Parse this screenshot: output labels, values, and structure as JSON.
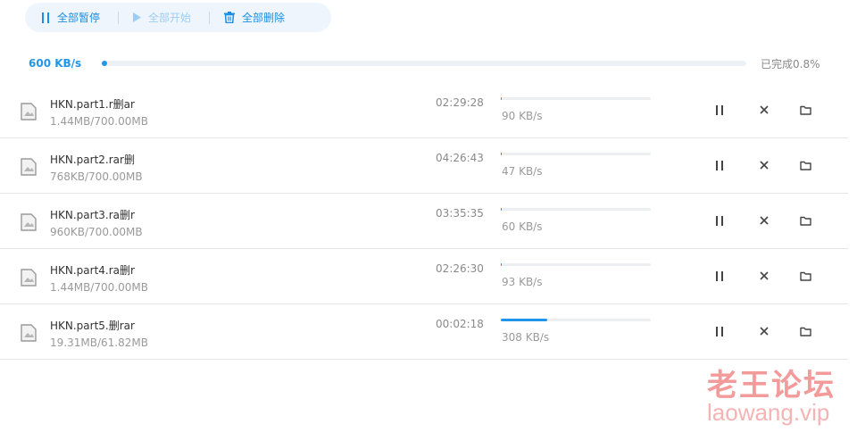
{
  "toolbar": {
    "pause_all_label": "全部暂停",
    "start_all_label": "全部开始",
    "delete_all_label": "全部删除"
  },
  "overall": {
    "speed": "600 KB/s",
    "status": "已完成0.8%",
    "progress_percent": 0.8
  },
  "downloads": [
    {
      "name": "HKN.part1.r删ar",
      "size": "1.44MB/700.00MB",
      "time_left": "02:29:28",
      "speed": "90 KB/s",
      "progress": 0.002
    },
    {
      "name": "HKN.part2.rar删",
      "size": "768KB/700.00MB",
      "time_left": "04:26:43",
      "speed": "47 KB/s",
      "progress": 0.001
    },
    {
      "name": "HKN.part3.ra删r",
      "size": "960KB/700.00MB",
      "time_left": "03:35:35",
      "speed": "60 KB/s",
      "progress": 0.001
    },
    {
      "name": "HKN.part4.ra删r",
      "size": "1.44MB/700.00MB",
      "time_left": "02:26:30",
      "speed": "93 KB/s",
      "progress": 0.002
    },
    {
      "name": "HKN.part5.删rar",
      "size": "19.31MB/61.82MB",
      "time_left": "00:02:18",
      "speed": "308 KB/s",
      "progress": 0.31
    }
  ],
  "watermark": {
    "title": "老王论坛",
    "url": "laowang.vip"
  },
  "colors": {
    "accent": "#2196e8",
    "toolbar_bg": "#eef5fd",
    "watermark": "#f39a9a"
  }
}
